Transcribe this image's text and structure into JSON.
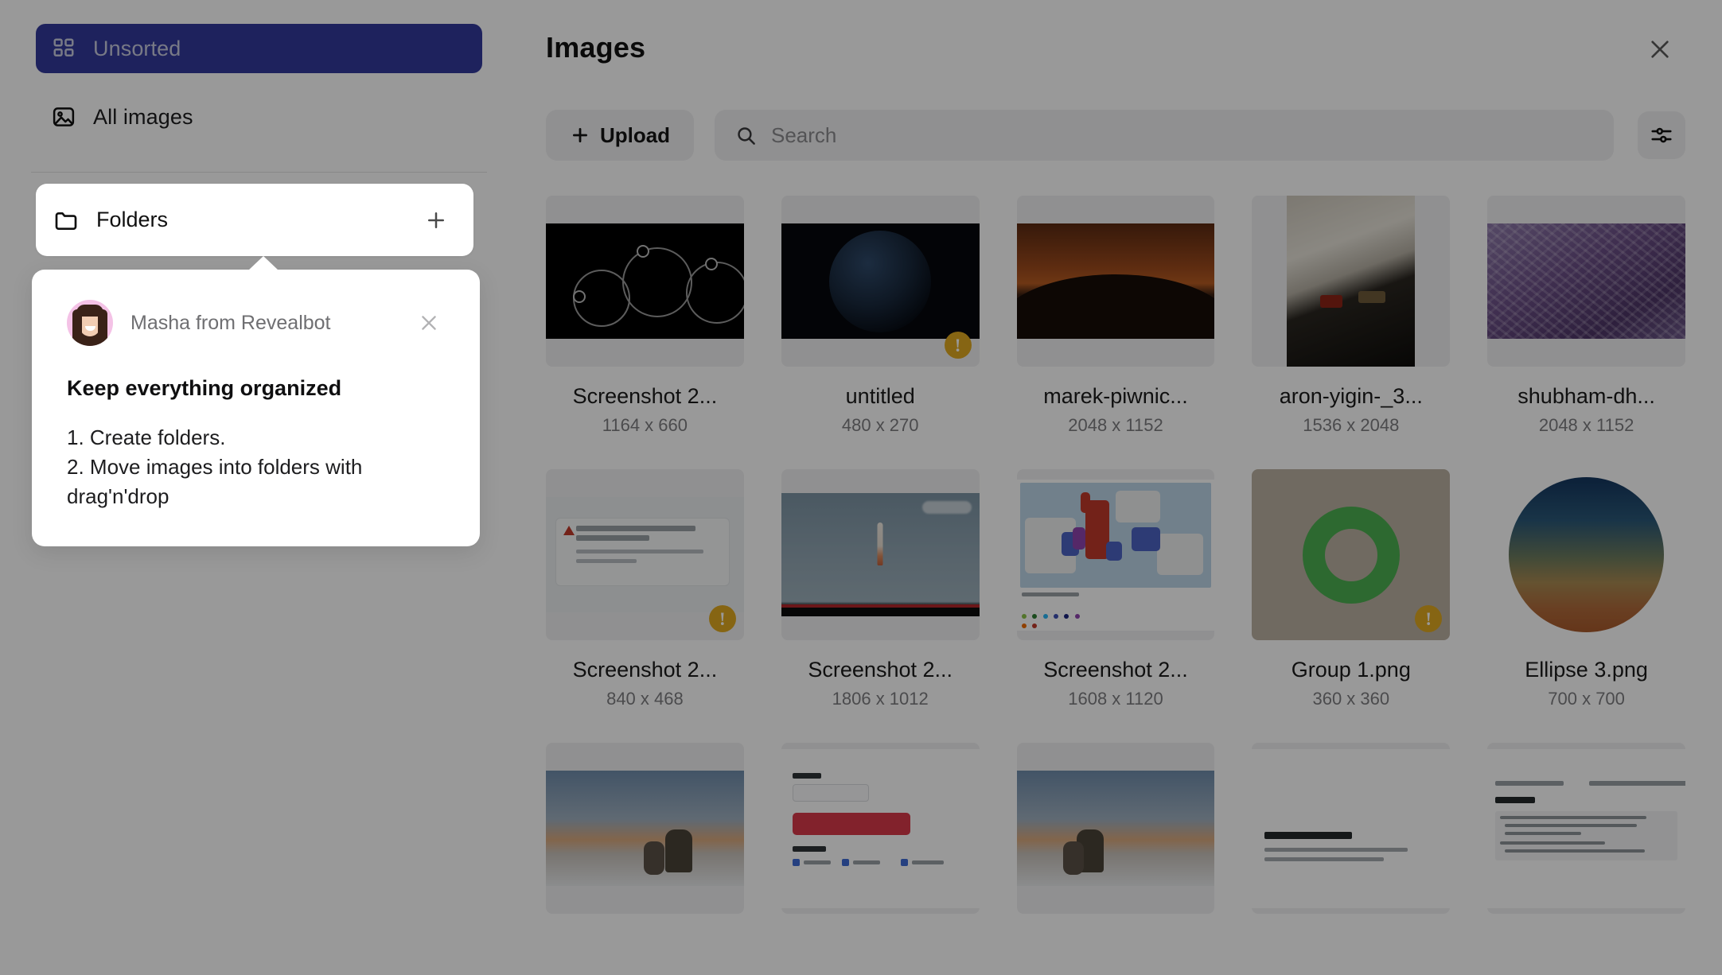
{
  "sidebar": {
    "items": [
      {
        "label": "Unsorted",
        "icon": "grid-icon",
        "active": true
      },
      {
        "label": "All images",
        "icon": "image-icon",
        "active": false
      }
    ],
    "folders": {
      "label": "Folders",
      "icon": "folder-icon",
      "add_icon": "plus-icon"
    }
  },
  "popover": {
    "author": "Masha from Revealbot",
    "avatar": "avatar-masha",
    "close_icon": "close-icon",
    "title": "Keep everything organized",
    "lines": [
      "1. Create folders.",
      "2. Move images into folders with drag'n'drop"
    ]
  },
  "main": {
    "title": "Images",
    "close_icon": "close-icon",
    "upload_label": "Upload",
    "upload_icon": "plus-icon",
    "search_icon": "search-icon",
    "search_placeholder": "Search",
    "search_value": "",
    "filter_icon": "sliders-icon",
    "warning_badge_glyph": "!"
  },
  "colors": {
    "accent": "#33399b",
    "warning_badge": "#e0a920",
    "panel_bg": "#f1f1f2",
    "scrim": "rgba(0,0,0,0.40)"
  },
  "grid": {
    "items": [
      {
        "name": "Screenshot 2...",
        "dims": "1164 x 660",
        "art": "t-diagram",
        "warning": false,
        "ratio": "wide"
      },
      {
        "name": "untitled",
        "dims": "480 x 270",
        "art": "t-space",
        "warning": true,
        "ratio": "wide"
      },
      {
        "name": "marek-piwnic...",
        "dims": "2048 x 1152",
        "art": "t-dune",
        "warning": false,
        "ratio": "wide"
      },
      {
        "name": "aron-yigin-_3...",
        "dims": "1536 x 2048",
        "art": "t-car",
        "warning": false,
        "ratio": "tall"
      },
      {
        "name": "shubham-dh...",
        "dims": "2048 x 1152",
        "art": "t-purple",
        "warning": false,
        "ratio": "wide"
      },
      {
        "name": "Screenshot 2...",
        "dims": "840 x 468",
        "art": "t-doc",
        "warning": true,
        "ratio": "wide"
      },
      {
        "name": "Screenshot 2...",
        "dims": "1806 x 1012",
        "art": "t-video",
        "warning": false,
        "ratio": "wide"
      },
      {
        "name": "Screenshot 2...",
        "dims": "1608 x 1120",
        "art": "t-map",
        "warning": false,
        "ratio": "wide"
      },
      {
        "name": "Group 1.png",
        "dims": "360 x 360",
        "art": "t-group",
        "warning": true,
        "ratio": "square"
      },
      {
        "name": "Ellipse 3.png",
        "dims": "700 x 700",
        "art": "t-ellipse",
        "warning": false,
        "ratio": "square"
      },
      {
        "name": "",
        "dims": "",
        "art": "t-horse",
        "warning": false,
        "ratio": "wide"
      },
      {
        "name": "",
        "dims": "",
        "art": "t-form",
        "warning": false,
        "ratio": "wide"
      },
      {
        "name": "",
        "dims": "",
        "art": "t-horse",
        "warning": false,
        "ratio": "wide"
      },
      {
        "name": "",
        "dims": "",
        "art": "t-plan",
        "warning": false,
        "ratio": "wide"
      },
      {
        "name": "",
        "dims": "",
        "art": "t-log",
        "warning": false,
        "ratio": "wide"
      }
    ]
  }
}
